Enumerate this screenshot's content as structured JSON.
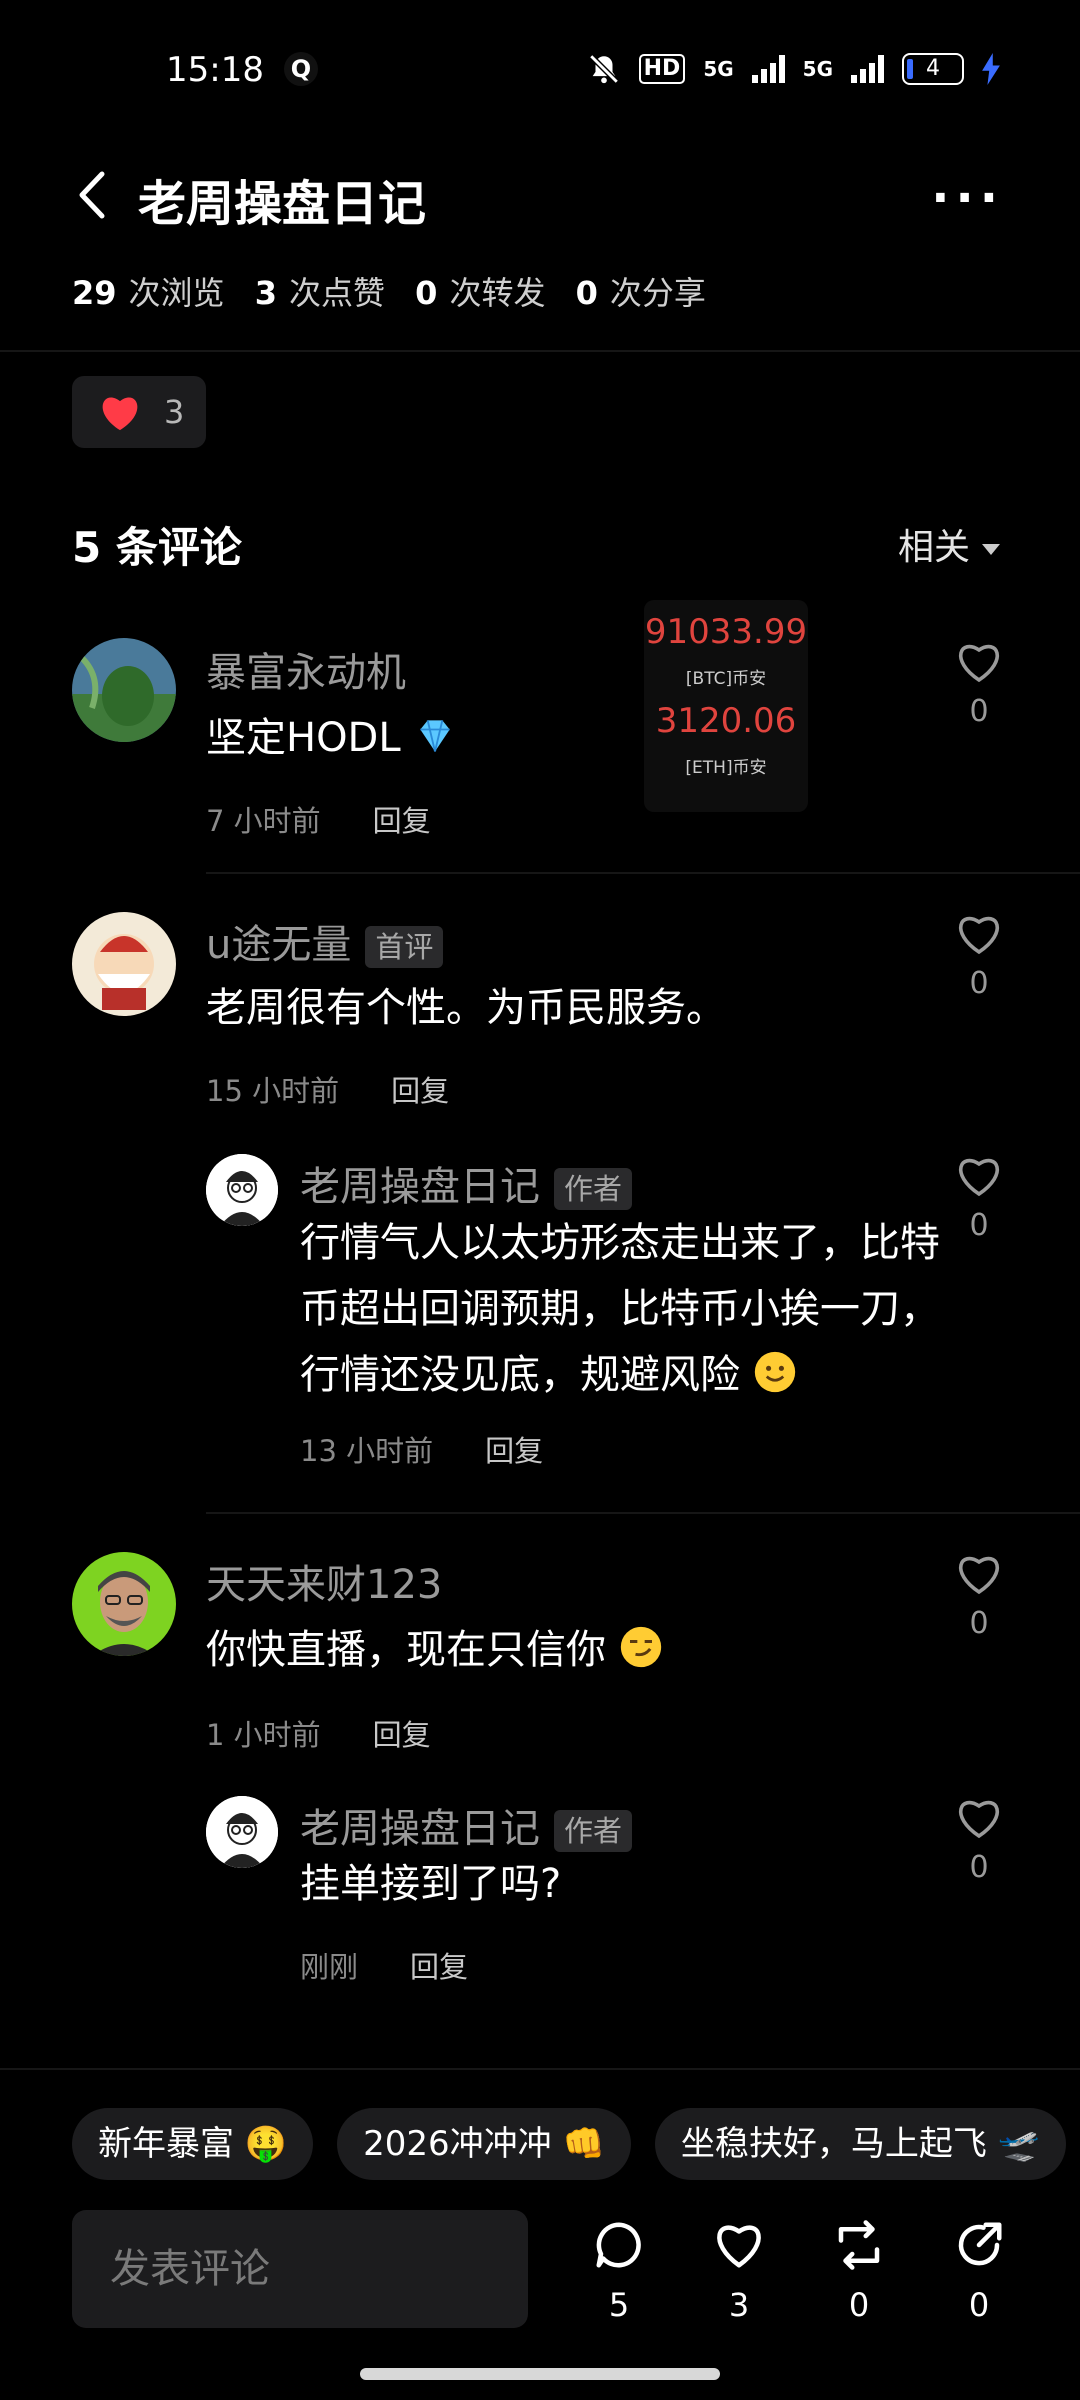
{
  "status_bar": {
    "time": "15:18",
    "app_icon": "Q",
    "hd": "HD",
    "signal_1": "5G",
    "signal_2": "5G",
    "battery": "4"
  },
  "header": {
    "title": "老周操盘日记",
    "more": "···"
  },
  "stats": {
    "views_num": "29",
    "views_label": "次浏览",
    "likes_num": "3",
    "likes_label": "次点赞",
    "forwards_num": "0",
    "forwards_label": "次转发",
    "shares_num": "0",
    "shares_label": "次分享"
  },
  "like_chip": {
    "count": "3"
  },
  "comments_header": {
    "count_label": "5 条评论",
    "sort_label": "相关"
  },
  "ticker": {
    "btc_value": "91033.99",
    "btc_label": "[BTC]币安",
    "eth_value": "3120.06",
    "eth_label": "[ETH]币安"
  },
  "comments": [
    {
      "user": "暴富永动机",
      "text": "坚定HODL",
      "emoji": "gem-emoji",
      "time": "7 小时前",
      "reply": "回复",
      "likes": "0"
    },
    {
      "user": "u途无量",
      "tag": "首评",
      "text": "老周很有个性。为币民服务。",
      "time": "15 小时前",
      "reply": "回复",
      "likes": "0",
      "replies": [
        {
          "user": "老周操盘日记",
          "tag": "作者",
          "text": "行情气人以太坊形态走出来了，比特币超出回调预期，比特币小挨一刀，行情还没见底，规避风险",
          "emoji": "smile-emoji",
          "time": "13 小时前",
          "reply": "回复",
          "likes": "0"
        }
      ]
    },
    {
      "user": "天天来财123",
      "text": "你快直播，现在只信你",
      "emoji": "smirk-emoji",
      "time": "1 小时前",
      "reply": "回复",
      "likes": "0",
      "replies": [
        {
          "user": "老周操盘日记",
          "tag": "作者",
          "text": "挂单接到了吗?",
          "time": "刚刚",
          "reply": "回复",
          "likes": "0"
        }
      ]
    }
  ],
  "quick_replies": [
    "新年暴富 🤑",
    "2026冲冲冲 👊",
    "坐稳扶好，马上起飞 🛫"
  ],
  "bottom_bar": {
    "placeholder": "发表评论",
    "comments": "5",
    "likes": "3",
    "forwards": "0",
    "shares": "0"
  },
  "colors": {
    "background": "#000000",
    "price_red": "#e0443e",
    "heart_red": "#ff3b47",
    "chip_bg": "#1c1c1e"
  }
}
